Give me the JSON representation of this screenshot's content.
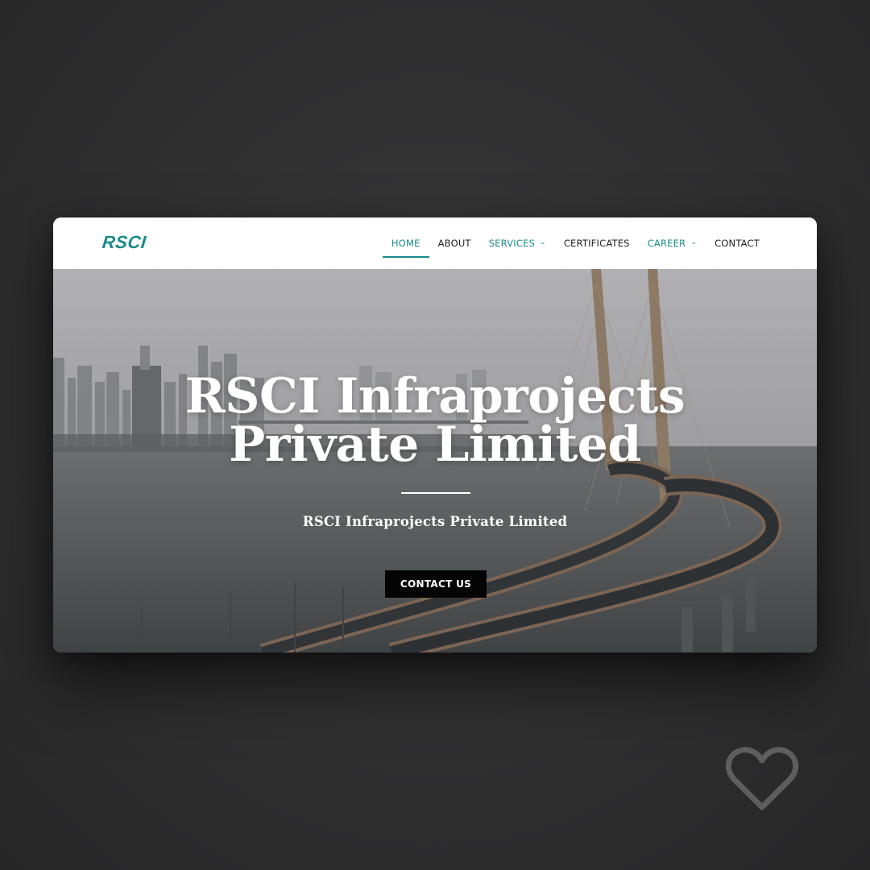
{
  "brand": {
    "logo_text": "RSCI",
    "accent": "#1a8a8a"
  },
  "nav": {
    "items": [
      {
        "label": "HOME",
        "active": true,
        "dropdown": false
      },
      {
        "label": "ABOUT",
        "active": false,
        "dropdown": false
      },
      {
        "label": "SERVICES",
        "active": false,
        "dropdown": true
      },
      {
        "label": "CERTIFICATES",
        "active": false,
        "dropdown": false
      },
      {
        "label": "CAREER",
        "active": false,
        "dropdown": true
      },
      {
        "label": "CONTACT",
        "active": false,
        "dropdown": false
      }
    ]
  },
  "hero": {
    "title_line1": "RSCI Infraprojects",
    "title_line2": "Private Limited",
    "subtitle": "RSCI Infraprojects Private Limited",
    "cta_label": "CONTACT US",
    "background": "sea-link-bridge-city-skyline"
  },
  "overlay_icon": "heart-outline-icon",
  "colors": {
    "nav_text": "#1f1f1f",
    "button_bg": "#050505",
    "page_bg": "#2f2f30"
  }
}
